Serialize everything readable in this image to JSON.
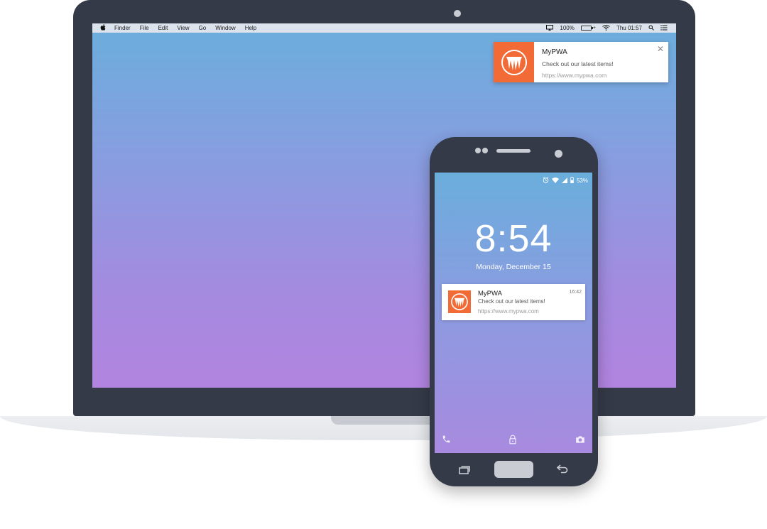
{
  "mac": {
    "menubar": {
      "apple_icon": "apple-logo-icon",
      "menus": [
        "Finder",
        "File",
        "Edit",
        "View",
        "Go",
        "Window",
        "Help"
      ],
      "status": {
        "airplay_icon": "airplay-icon",
        "battery_percent": "100%",
        "battery_level": 1.0,
        "battery_color": "#2bc94c",
        "wifi_icon": "wifi-icon",
        "clock": "Thu 01:57",
        "search_icon": "spotlight-search-icon",
        "notification_center_icon": "list-icon"
      }
    },
    "notification": {
      "app_icon": "mypwa-logo-icon",
      "title": "MyPWA",
      "message": "Check out our latest items!",
      "url": "https://www.mypwa.com",
      "close_glyph": "✕"
    }
  },
  "phone": {
    "statusbar": {
      "alarm_icon": "alarm-icon",
      "wifi_icon": "wifi-icon",
      "signal_icon": "signal-icon",
      "battery_icon": "battery-icon",
      "battery_percent": "53%"
    },
    "lockscreen": {
      "time": "8:54",
      "date": "Monday, December 15"
    },
    "notification": {
      "app_icon": "mypwa-logo-icon",
      "title": "MyPWA",
      "message": "Check out our latest items!",
      "url": "https://www.mypwa.com",
      "time": "16:42"
    },
    "shortcuts": [
      "phone-icon",
      "lock-icon",
      "camera-icon"
    ],
    "navigation": [
      "recent-apps-icon",
      "home-button",
      "back-icon"
    ]
  },
  "colors": {
    "brand_orange": "#f26a35",
    "device_frame": "#353a48",
    "wallpaper_top": "#6aaedc",
    "wallpaper_bottom": "#b184e0"
  }
}
